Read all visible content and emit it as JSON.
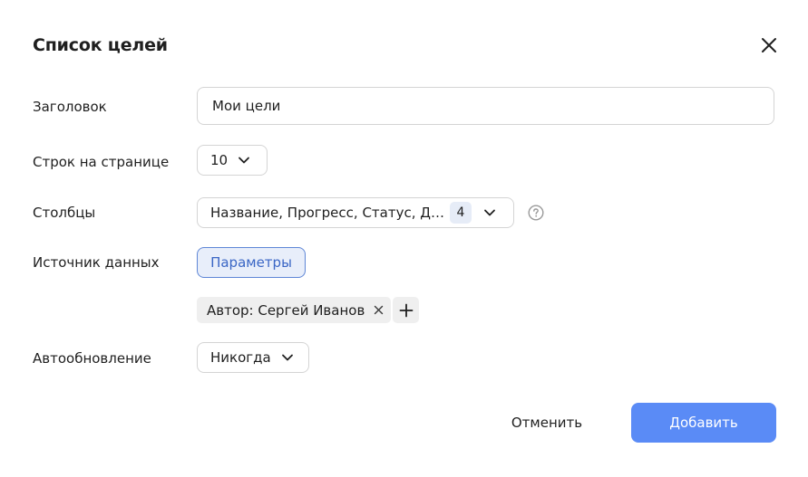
{
  "dialog": {
    "title": "Список целей"
  },
  "fields": {
    "header_label": "Заголовок",
    "header_value": "Мои цели",
    "rows_label": "Строк на странице",
    "rows_value": "10",
    "columns_label": "Столбцы",
    "columns_value": "Название, Прогресс, Статус, Де...",
    "columns_count": "4",
    "source_label": "Источник данных",
    "params_button": "Параметры",
    "filter_chip": "Автор: Сергей Иванов",
    "autorefresh_label": "Автообновление",
    "autorefresh_value": "Никогда"
  },
  "footer": {
    "cancel_label": "Отменить",
    "add_label": "Добавить"
  },
  "colors": {
    "primary": "#5a8bf6",
    "params_border": "#5e86d6",
    "params_bg": "#e8eefa",
    "chip_bg": "#efefef"
  },
  "icons": [
    "close-icon",
    "chevron-down-icon",
    "question-icon",
    "remove-icon",
    "plus-icon"
  ]
}
